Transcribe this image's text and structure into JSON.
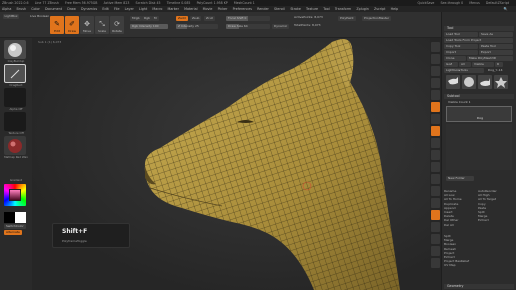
{
  "titlebar": {
    "items": [
      "ZBrush 2022.0.6",
      "Line 77 ZBrush",
      "Free Mem 56.975GB",
      "Active Mem 823",
      "Scratch Disk 45",
      "Timeline 0.085",
      "PolyCount 1.958 KP",
      "MeshCount 1"
    ],
    "right": [
      "QuickSave",
      "See-through 0",
      "Menus",
      "DefaultZScript"
    ]
  },
  "menubar": {
    "items": [
      "Alpha",
      "Brush",
      "Color",
      "Document",
      "Draw",
      "Dynamics",
      "Edit",
      "File",
      "Layer",
      "Light",
      "Macro",
      "Marker",
      "Material",
      "Movie",
      "Picker",
      "Preferences",
      "Render",
      "Stencil",
      "Stroke",
      "Texture",
      "Tool",
      "Transform",
      "Zplugin",
      "Zscript",
      "Help"
    ],
    "right": "🔍"
  },
  "topshelf": {
    "lightbox": "LightBox",
    "live_boolean": "Live Boolean",
    "edit": "Edit",
    "draw": "Draw",
    "move": "Move",
    "scale": "Scale",
    "rotate": "Rotate",
    "mrgb": "Mrgb",
    "rgb": "Rgb",
    "m": "M",
    "zadd": "Zadd",
    "zsub": "Zsub",
    "zcut": "Zcut",
    "rgb_intensity": "Rgb Intensity 100",
    "z_intensity": "Z Intensity 25",
    "focal_shift": "Focal Shift 0",
    "draw_size": "Draw Size 64",
    "dynamic": "Dynamic",
    "active_points": "ActivePoints: 8,073",
    "total_points": "TotalPoints: 8,073",
    "polypaint": "PolyPaint",
    "projectionmaster": "ProjectionMaster",
    "z_intensity_value": 0.25,
    "focal_shift_value": 0.5,
    "draw_size_value": 0.3
  },
  "leftshelf": {
    "brushes": [
      "Standard",
      "ClayBuildup",
      "Move",
      "Dam_Standard",
      "TrimDynamic"
    ],
    "stroke": "DragRect",
    "alpha": "Alpha Off",
    "texture": "Texture Off",
    "material": "MatCap Red Wax",
    "gradient": "Gradient",
    "switch_color": "SwitchColor",
    "alternate": "Alternate"
  },
  "canvas": {
    "info": "Sub 1 (1) 6,073"
  },
  "tray": {
    "load_tool": "Load Tool",
    "save_as": "Save As",
    "load_tools_from_project": "Load Tools From Project",
    "copy_tool": "Copy Tool",
    "paste_tool": "Paste Tool",
    "import": "Import",
    "export": "Export",
    "clone": "Clone",
    "make_polymesh3d": "Make PolyMesh3D",
    "goz": "GoZ",
    "all": "All",
    "visible": "Visible",
    "r": "R",
    "lightbox_tools": "Lightbox▸Tools",
    "tool_name": "Dog_Y..14",
    "subtool_header": "Subtool",
    "subtool_count": "Visible Count 1",
    "subtool_item": "Dog",
    "new_folder": "New Folder",
    "list1": [
      "Rename",
      "All Low",
      "All To Home",
      "Duplicate",
      "Append",
      "Insert",
      "Delete",
      "Del Other",
      "Del All"
    ],
    "list1b": [
      "AutoReorder",
      "All High",
      "All To Target",
      "Copy",
      "Paste",
      "Split",
      "Merge",
      "Extract"
    ],
    "list2": [
      "Split",
      "Merge",
      "Boolean",
      "Remesh",
      "Project",
      "Extract",
      "Project BasRelief",
      "UV Map",
      "Geometry"
    ],
    "geometry": "Geometry"
  },
  "hint": {
    "keys": "Shift+F",
    "sub": "PolyframeToggle"
  },
  "colors": {
    "accent": "#e0741c",
    "model": "#b59a45",
    "wire": "#2a2410"
  }
}
